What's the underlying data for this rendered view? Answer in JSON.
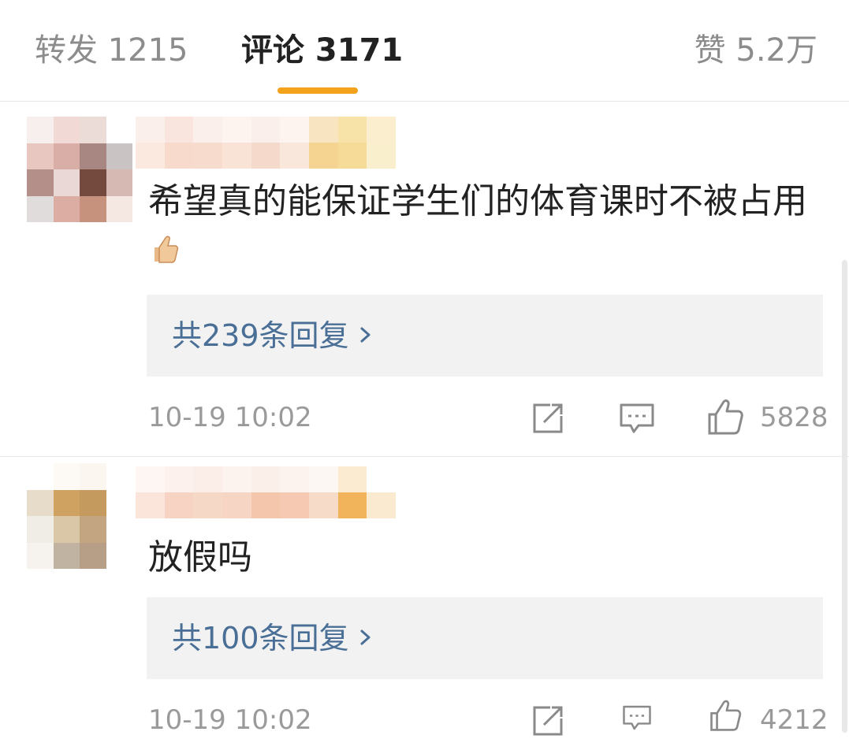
{
  "tabs": {
    "reposts": "转发 1215",
    "comments": "评论 3171",
    "likes": "赞 5.2万"
  },
  "comments": [
    {
      "text": "希望真的能保证学生们的体育课时不被占用",
      "emoji": "thumbs-up-emoji",
      "replies_label": "共239条回复",
      "timestamp": "10-19 10:02",
      "like_count": "5828"
    },
    {
      "text": "放假吗",
      "replies_label": "共100条回复",
      "timestamp": "10-19 10:02",
      "like_count": "4212"
    }
  ],
  "icons": {
    "share": "share-icon",
    "comment": "comment-icon",
    "like": "like-icon",
    "chevron": "chevron-right-icon"
  },
  "colors": {
    "accent": "#f3a31b",
    "link": "#4a6f96",
    "muted": "#9a9a9a",
    "reply_bg": "#f2f2f2"
  }
}
